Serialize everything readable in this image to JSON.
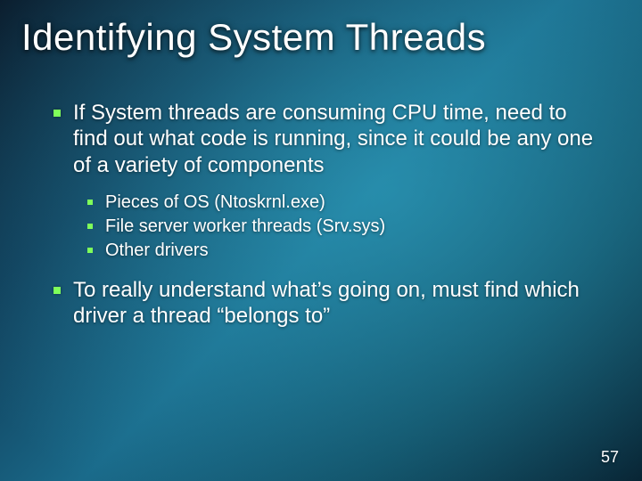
{
  "title": "Identifying System Threads",
  "bullets": [
    {
      "text": "If System threads are consuming CPU time, need to find out what code is running, since it could be any one of a variety of components",
      "sub": [
        "Pieces of OS (Ntoskrnl.exe)",
        "File server worker threads (Srv.sys)",
        "Other drivers"
      ]
    },
    {
      "text": "To really understand what’s going on, must find which driver a thread “belongs to”"
    }
  ],
  "slide_number": "57"
}
